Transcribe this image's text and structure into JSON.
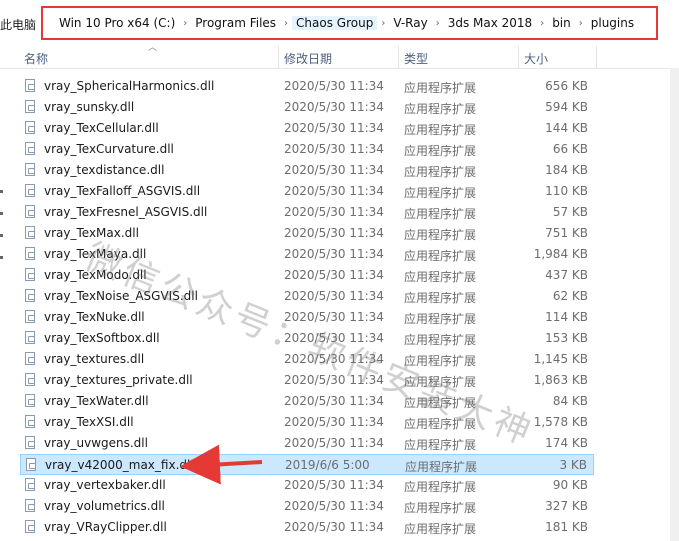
{
  "breadcrumb": {
    "this_pc": "此电脑",
    "items": [
      "Win 10 Pro x64 (C:)",
      "Program Files",
      "Chaos Group",
      "V-Ray",
      "3ds Max 2018",
      "bin",
      "plugins"
    ],
    "separator": "›"
  },
  "columns": {
    "name": "名称",
    "date": "修改日期",
    "type": "类型",
    "size": "大小"
  },
  "files": [
    {
      "name": "vray_SphericalHarmonics.dll",
      "date": "2020/5/30 11:34",
      "type": "应用程序扩展",
      "size": "656 KB"
    },
    {
      "name": "vray_sunsky.dll",
      "date": "2020/5/30 11:34",
      "type": "应用程序扩展",
      "size": "594 KB"
    },
    {
      "name": "vray_TexCellular.dll",
      "date": "2020/5/30 11:34",
      "type": "应用程序扩展",
      "size": "144 KB"
    },
    {
      "name": "vray_TexCurvature.dll",
      "date": "2020/5/30 11:34",
      "type": "应用程序扩展",
      "size": "66 KB"
    },
    {
      "name": "vray_texdistance.dll",
      "date": "2020/5/30 11:34",
      "type": "应用程序扩展",
      "size": "184 KB"
    },
    {
      "name": "vray_TexFalloff_ASGVIS.dll",
      "date": "2020/5/30 11:34",
      "type": "应用程序扩展",
      "size": "110 KB"
    },
    {
      "name": "vray_TexFresnel_ASGVIS.dll",
      "date": "2020/5/30 11:34",
      "type": "应用程序扩展",
      "size": "57 KB"
    },
    {
      "name": "vray_TexMax.dll",
      "date": "2020/5/30 11:34",
      "type": "应用程序扩展",
      "size": "751 KB"
    },
    {
      "name": "vray_TexMaya.dll",
      "date": "2020/5/30 11:34",
      "type": "应用程序扩展",
      "size": "1,984 KB"
    },
    {
      "name": "vray_TexModo.dll",
      "date": "2020/5/30 11:34",
      "type": "应用程序扩展",
      "size": "437 KB"
    },
    {
      "name": "vray_TexNoise_ASGVIS.dll",
      "date": "2020/5/30 11:34",
      "type": "应用程序扩展",
      "size": "62 KB"
    },
    {
      "name": "vray_TexNuke.dll",
      "date": "2020/5/30 11:34",
      "type": "应用程序扩展",
      "size": "114 KB"
    },
    {
      "name": "vray_TexSoftbox.dll",
      "date": "2020/5/30 11:34",
      "type": "应用程序扩展",
      "size": "153 KB"
    },
    {
      "name": "vray_textures.dll",
      "date": "2020/5/30 11:34",
      "type": "应用程序扩展",
      "size": "1,145 KB"
    },
    {
      "name": "vray_textures_private.dll",
      "date": "2020/5/30 11:34",
      "type": "应用程序扩展",
      "size": "1,863 KB"
    },
    {
      "name": "vray_TexWater.dll",
      "date": "2020/5/30 11:34",
      "type": "应用程序扩展",
      "size": "84 KB"
    },
    {
      "name": "vray_TexXSI.dll",
      "date": "2020/5/30 11:34",
      "type": "应用程序扩展",
      "size": "1,578 KB"
    },
    {
      "name": "vray_uvwgens.dll",
      "date": "2020/5/30 11:34",
      "type": "应用程序扩展",
      "size": "174 KB"
    },
    {
      "name": "vray_v42000_max_fix.dll",
      "date": "2019/6/6 5:00",
      "type": "应用程序扩展",
      "size": "3 KB",
      "highlighted": true
    },
    {
      "name": "vray_vertexbaker.dll",
      "date": "2020/5/30 11:34",
      "type": "应用程序扩展",
      "size": "90 KB"
    },
    {
      "name": "vray_volumetrics.dll",
      "date": "2020/5/30 11:34",
      "type": "应用程序扩展",
      "size": "327 KB"
    },
    {
      "name": "vray_VRayClipper.dll",
      "date": "2020/5/30 11:34",
      "type": "应用程序扩展",
      "size": "181 KB"
    }
  ],
  "watermark": "微信公众号：软件安装大神",
  "colors": {
    "highlight_box": "#e53935",
    "selected_row": "#cce8ff",
    "arrow": "#e53935"
  }
}
